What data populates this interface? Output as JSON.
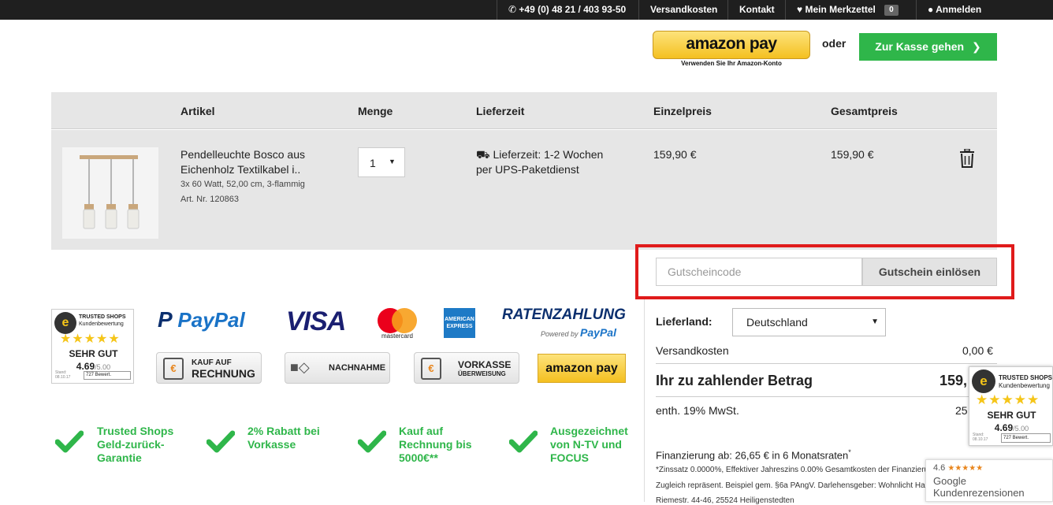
{
  "topbar": {
    "phone": "+49 (0) 48 21 / 403 93-50",
    "shipping": "Versandkosten",
    "contact": "Kontakt",
    "wishlist": "Mein Merkzettel",
    "wishlist_count": "0",
    "login": "Anmelden"
  },
  "checkout_top": {
    "amazon_pay_label": "amazon pay",
    "amazon_pay_sub": "Verwenden Sie Ihr Amazon-Konto",
    "or": "oder",
    "checkout_button": "Zur Kasse gehen"
  },
  "cart": {
    "columns": [
      "Artikel",
      "Menge",
      "Lieferzeit",
      "Einzelpreis",
      "Gesamtpreis"
    ],
    "item": {
      "name": "Pendelleuchte Bosco aus Eichenholz Textilkabel i..",
      "details": "3x 60 Watt, 52,00 cm, 3-flammig",
      "article_no": "Art. Nr. 120863",
      "quantity": "1",
      "delivery": "Lieferzeit: 1-2 Wochen per UPS-Paketdienst",
      "unit_price": "159,90 €",
      "total_price": "159,90 €"
    }
  },
  "voucher": {
    "placeholder": "Gutscheincode",
    "button": "Gutschein einlösen"
  },
  "summary": {
    "country_label": "Lieferland:",
    "country_value": "Deutschland",
    "shipping_label": "Versandkosten",
    "shipping_value": "0,00 €",
    "total_label": "Ihr zu zahlender Betrag",
    "total_value": "159,",
    "vat_label": "enth. 19% MwSt.",
    "vat_value": "25",
    "financing": "Finanzierung ab: 26,65 € in 6 Monatsraten",
    "financing_mark": "*",
    "fine_print_1": "*Zinssatz 0.0000%, Effektiver Jahreszins 0.00% Gesamtkosten der Finanzierung",
    "fine_print_2": "Zugleich repräsent. Beispiel gem. §6a PAngV. Darlehensgeber: Wohnlicht Ha",
    "fine_print_3": "Riemestr. 44-46, 25524 Heiligenstedten"
  },
  "payments": {
    "paypal": "PayPal",
    "visa": "VISA",
    "mastercard": "mastercard",
    "amex": "AMERICAN EXPRESS",
    "ratenzahlung": "RATENZAHLUNG",
    "ratenzahlung_sub": "Powered by",
    "ratenzahlung_brand": "PayPal",
    "rechnung_1": "KAUF AUF",
    "rechnung_2": "RECHNUNG",
    "nachnahme": "NACHNAHME",
    "vorkasse_1": "VORKASSE",
    "vorkasse_2": "ÜBERWEISUNG",
    "amazon_pay": "amazon pay"
  },
  "trusted_badge": {
    "title": "TRUSTED SHOPS",
    "subtitle": "Kundenbewertung",
    "rating_word": "SEHR GUT",
    "score": "4.69",
    "max": "/5.00",
    "stand_label": "Stand:",
    "stand_date": "08.10.17",
    "reviews": "727 Bewert."
  },
  "usps": [
    {
      "line1": "Trusted Shops",
      "line2": "Geld-zurück-",
      "line3": "Garantie"
    },
    {
      "line1": "2% Rabatt bei",
      "line2": "Vorkasse",
      "line3": ""
    },
    {
      "line1": "Kauf auf",
      "line2": "Rechnung bis",
      "line3": "5000€**"
    },
    {
      "line1": "Ausgezeichnet",
      "line2": "von N-TV und",
      "line3": "FOCUS"
    }
  ],
  "google": {
    "rating": "4.6",
    "stars": "★★★★★",
    "brand": "Google",
    "label": "Kundenrezensionen"
  },
  "colors": {
    "accent_green": "#2fb64a",
    "highlight_red": "#e01b1b",
    "topbar": "#1f1f1f"
  }
}
